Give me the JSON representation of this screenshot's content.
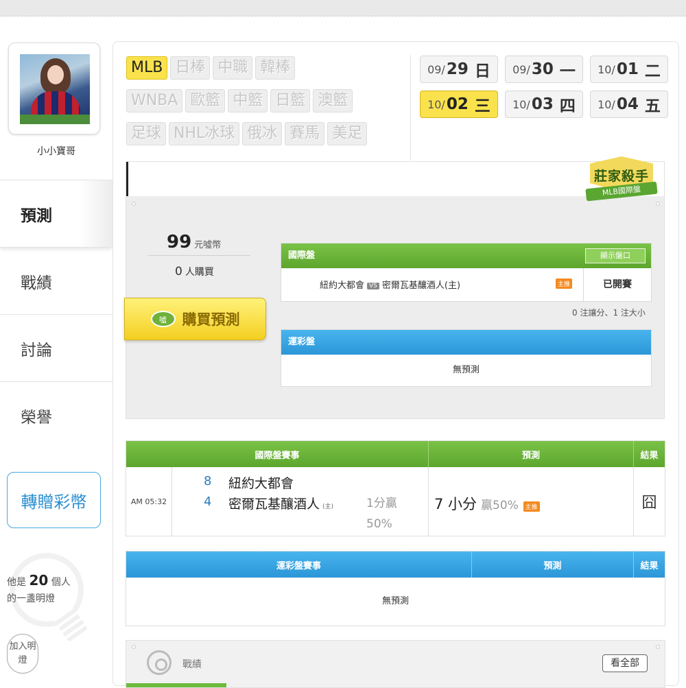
{
  "user": {
    "name": "小小寶哥"
  },
  "sidebar": {
    "items": [
      {
        "label": "預測"
      },
      {
        "label": "戰績"
      },
      {
        "label": "討論"
      },
      {
        "label": "榮譽"
      }
    ],
    "gift_button": "轉贈彩幣",
    "lamp": {
      "prefix": "他是",
      "count": "20",
      "suffix": "個人",
      "line2": "的一盞明燈"
    },
    "join_lamp": "加入明燈"
  },
  "league_tags": [
    {
      "label": "MLB",
      "active": true
    },
    {
      "label": "日棒"
    },
    {
      "label": "中職"
    },
    {
      "label": "韓棒"
    },
    {
      "label": "WNBA"
    },
    {
      "label": "歐籃"
    },
    {
      "label": "中籃"
    },
    {
      "label": "日籃"
    },
    {
      "label": "澳籃"
    },
    {
      "label": "足球"
    },
    {
      "label": "NHL冰球"
    },
    {
      "label": "俄冰"
    },
    {
      "label": "賽馬"
    },
    {
      "label": "美足"
    }
  ],
  "dates": [
    {
      "prefix": "09/",
      "day": "29",
      "weekday": "日"
    },
    {
      "prefix": "09/",
      "day": "30",
      "weekday": "一"
    },
    {
      "prefix": "10/",
      "day": "01",
      "weekday": "二"
    },
    {
      "prefix": "10/",
      "day": "02",
      "weekday": "三",
      "active": true
    },
    {
      "prefix": "10/",
      "day": "03",
      "weekday": "四"
    },
    {
      "prefix": "10/",
      "day": "04",
      "weekday": "五"
    }
  ],
  "badge": {
    "title": "莊家殺手",
    "subtitle": "MLB國際盤"
  },
  "prediction": {
    "price": "99",
    "price_unit": "元噓幣",
    "buyers_count": "0",
    "buyers_label": "人購買",
    "buy_button": "購買預測",
    "coin_label": "噓",
    "intl": {
      "header": "國際盤",
      "show_odds_button": "顯示盤口",
      "away": "紐約大都會",
      "vs": "VS",
      "home": "密爾瓦基釀酒人(主)",
      "tag": "主推",
      "status": "已開賽",
      "note": "0 注讓分、1 注大小"
    },
    "lotto": {
      "header": "運彩盤",
      "empty": "無預測"
    }
  },
  "intl_results": {
    "headers": [
      "國際盤賽事",
      "預測",
      "結果"
    ],
    "row": {
      "time": "AM 05:32",
      "away_score": "8",
      "away_team": "紐約大都會",
      "home_score": "4",
      "home_team": "密爾瓦基釀酒人",
      "home_mark": "(主)",
      "odds_line1": "1分贏",
      "odds_line2": "50%",
      "pick": "7 小分",
      "pick_odds": "贏50%",
      "pick_tag": "主推",
      "result": "囧"
    }
  },
  "lotto_results": {
    "headers": [
      "運彩盤賽事",
      "預測",
      "結果"
    ],
    "empty": "無預測"
  },
  "record": {
    "label": "戰績",
    "view_all": "看全部"
  }
}
